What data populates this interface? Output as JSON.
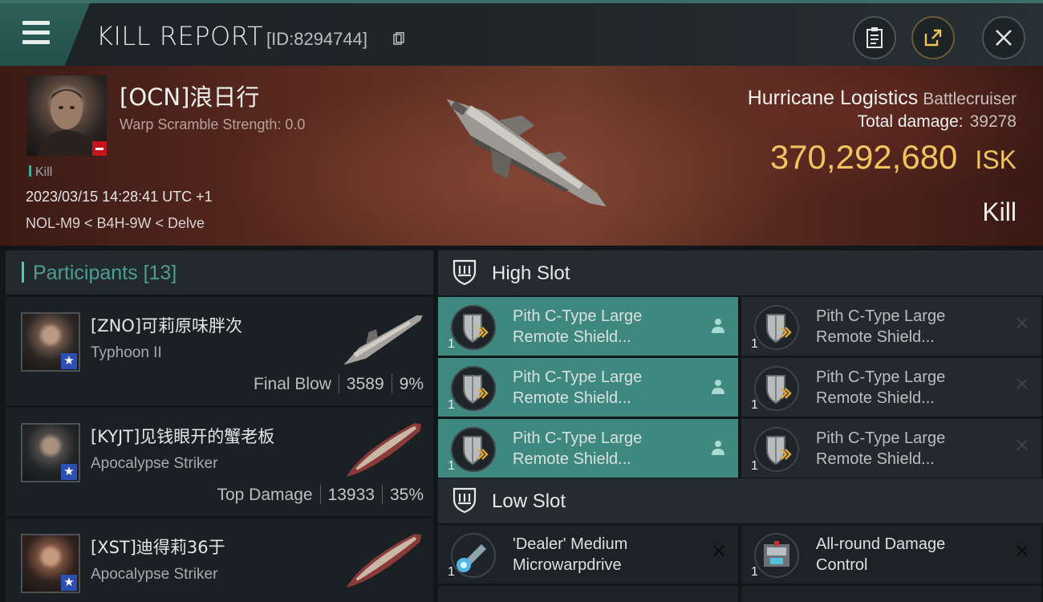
{
  "header": {
    "title": "KILL REPORT",
    "report_id": "[ID:8294744]"
  },
  "victim": {
    "name": "[OCN]浪日行",
    "warp_scramble": "Warp Scramble Strength: 0.0",
    "kill_tag": "Kill",
    "datetime": "2023/03/15 14:28:41 UTC +1",
    "location": "NOL-M9 < B4H-9W < Delve",
    "ship_name": "Hurricane Logistics",
    "ship_class": "Battlecruiser",
    "total_damage_label": "Total damage:",
    "total_damage_value": "39278",
    "isk_value": "370,292,680",
    "isk_unit": "ISK",
    "result": "Kill"
  },
  "participants": {
    "label": "Participants",
    "count": "[13]",
    "rows": [
      {
        "name": "[ZNO]可莉原味胖次",
        "ship": "Typhoon II",
        "role": "Final Blow",
        "damage": "3589",
        "percent": "9%"
      },
      {
        "name": "[KYJT]见钱眼开的蟹老板",
        "ship": "Apocalypse Striker",
        "role": "Top Damage",
        "damage": "13933",
        "percent": "35%"
      },
      {
        "name": "[XST]迪得莉36于",
        "ship": "Apocalypse Striker",
        "role": "",
        "damage": "",
        "percent": ""
      }
    ]
  },
  "high_slot": {
    "label": "High Slot",
    "modules": [
      {
        "name_line1": "Pith C-Type Large",
        "name_line2": "Remote Shield...",
        "qty": "1",
        "state": "on"
      },
      {
        "name_line1": "Pith C-Type Large",
        "name_line2": "Remote Shield...",
        "qty": "1",
        "state": "off"
      },
      {
        "name_line1": "Pith C-Type Large",
        "name_line2": "Remote Shield...",
        "qty": "1",
        "state": "on"
      },
      {
        "name_line1": "Pith C-Type Large",
        "name_line2": "Remote Shield...",
        "qty": "1",
        "state": "off"
      },
      {
        "name_line1": "Pith C-Type Large",
        "name_line2": "Remote Shield...",
        "qty": "1",
        "state": "on"
      },
      {
        "name_line1": "Pith C-Type Large",
        "name_line2": "Remote Shield...",
        "qty": "1",
        "state": "off"
      }
    ]
  },
  "low_slot": {
    "label": "Low Slot",
    "modules": [
      {
        "name_line1": "'Dealer' Medium",
        "name_line2": "Microwarpdrive",
        "qty": "1"
      },
      {
        "name_line1": "All-round Damage",
        "name_line2": "Control",
        "qty": "1"
      }
    ]
  },
  "colors": {
    "accent_teal": "#3f8880",
    "isk_gold": "#f1c45f",
    "badge_red": "#c8141e",
    "star_blue": "#2d4fb4"
  },
  "icons": {
    "menu": "menu-icon",
    "clipboard": "clipboard-icon",
    "share": "share-icon",
    "close": "close-icon",
    "copy": "copy-icon",
    "slot": "slot-shield-icon",
    "module": "shield-booster-icon",
    "person": "person-icon",
    "remove": "x-icon"
  }
}
